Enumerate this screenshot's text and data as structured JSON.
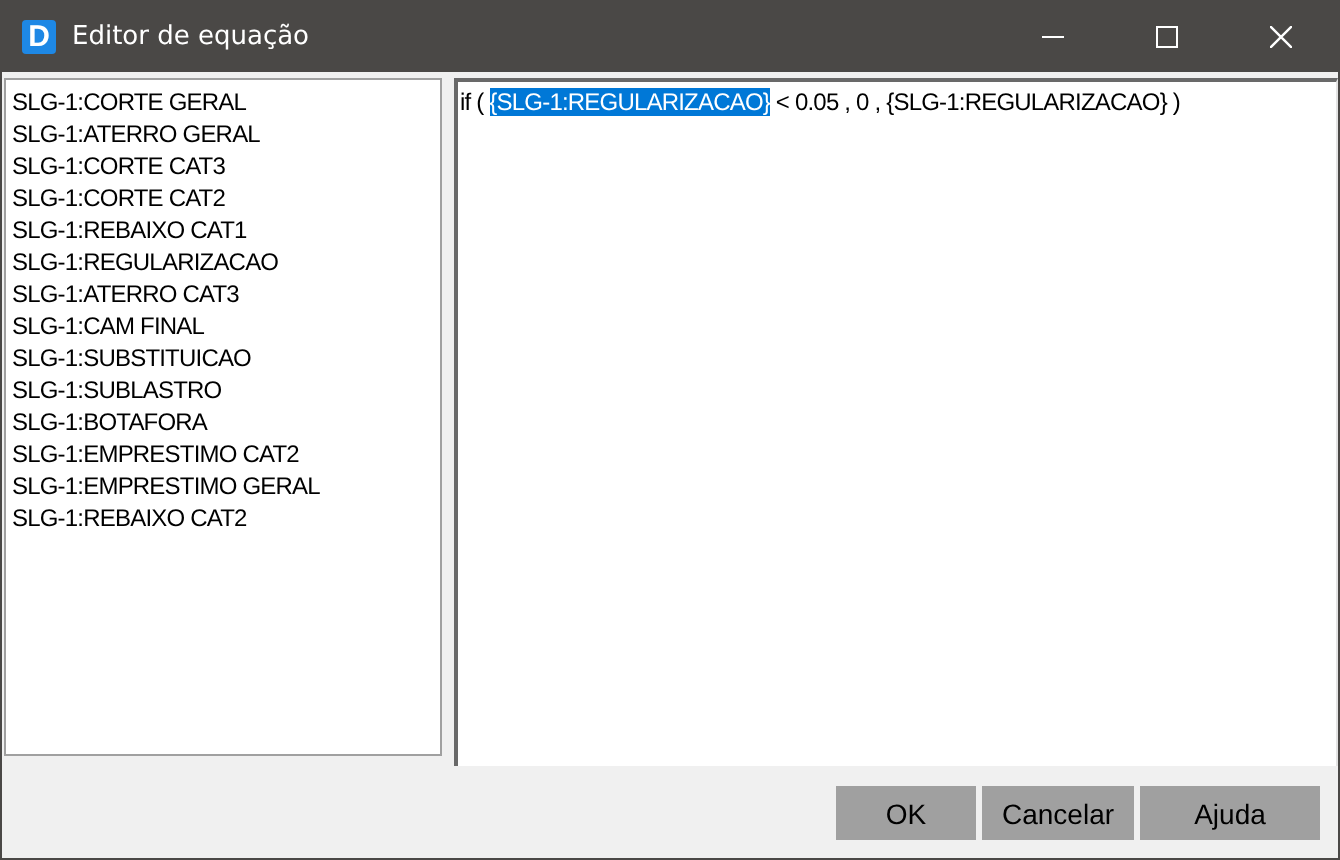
{
  "window": {
    "icon_letter": "D",
    "title": "Editor de equação"
  },
  "variables": [
    {
      "label": "SLG-1:CORTE GERAL"
    },
    {
      "label": "SLG-1:ATERRO GERAL"
    },
    {
      "label": "SLG-1:CORTE CAT3"
    },
    {
      "label": "SLG-1:CORTE CAT2"
    },
    {
      "label": "SLG-1:REBAIXO CAT1"
    },
    {
      "label": "SLG-1:REGULARIZACAO"
    },
    {
      "label": "SLG-1:ATERRO CAT3"
    },
    {
      "label": "SLG-1:CAM FINAL"
    },
    {
      "label": "SLG-1:SUBSTITUICAO"
    },
    {
      "label": "SLG-1:SUBLASTRO"
    },
    {
      "label": "SLG-1:BOTAFORA"
    },
    {
      "label": "SLG-1:EMPRESTIMO CAT2"
    },
    {
      "label": "SLG-1:EMPRESTIMO GERAL"
    },
    {
      "label": "SLG-1:REBAIXO CAT2"
    }
  ],
  "editor": {
    "segments": [
      {
        "text": "if ( ",
        "selected": false
      },
      {
        "text": "{SLG-1:REGULARIZACAO}",
        "selected": true
      },
      {
        "text": " < 0.05 , 0 , {SLG-1:REGULARIZACAO} )",
        "selected": false
      }
    ]
  },
  "buttons": [
    "OK",
    "Cancelar",
    "Ajuda"
  ]
}
